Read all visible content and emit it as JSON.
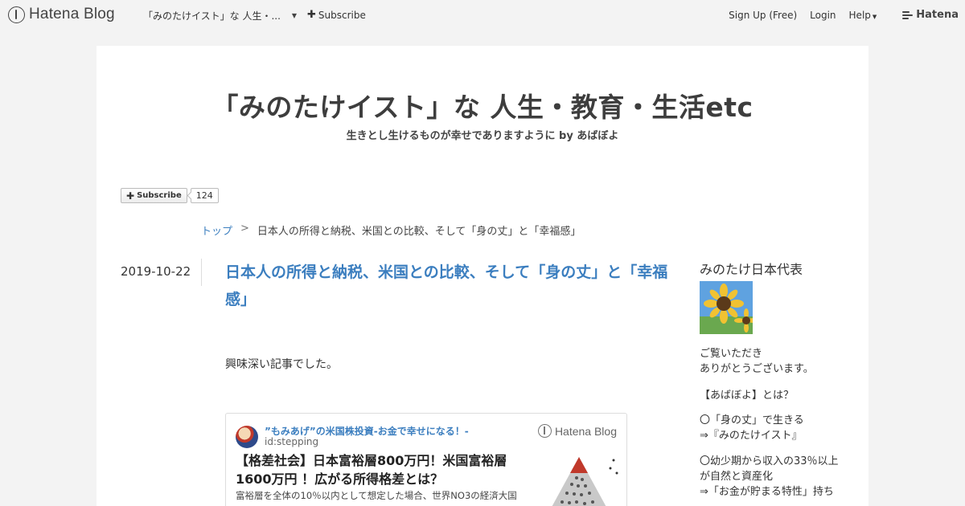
{
  "header": {
    "logo_text": "Hatena Blog",
    "blog_selector": "「みのたけイスト」な 人生・...",
    "subscribe": "Subscribe",
    "signup": "Sign Up (Free)",
    "login": "Login",
    "help": "Help",
    "brand": "Hatena"
  },
  "blog": {
    "title": "「みのたけイスト」な 人生・教育・生活etc",
    "description": "生きとし生けるものが幸せでありますように by あばぼよ"
  },
  "subscribe_widget": {
    "label": "Subscribe",
    "count": "124"
  },
  "breadcrumb": {
    "top": "トップ",
    "separator": ">",
    "current": "日本人の所得と納税、米国との比較、そして「身の丈」と「幸福感」"
  },
  "entry": {
    "date": "2019-10-22",
    "title": "日本人の所得と納税、米国との比較、そして「身の丈」と「幸福感」",
    "body": "興味深い記事でした。"
  },
  "embed_card": {
    "site": "”もみあげ”の米国株投資-お金で幸せになる！-",
    "id": "id:stepping",
    "brand": "Hatena Blog",
    "title": "【格差社会】日本富裕層800万円！米国富裕層1600万円 ！広がる所得格差とは？",
    "desc": "富裕層を全体の10％以内として想定した場合、世界NO3の経済大国"
  },
  "sidebar": {
    "profile_title": "みのたけ日本代表",
    "lines": [
      "ご覧いただき",
      "ありがとうございます。",
      "【あばぼよ】とは？",
      "〇「身の丈」で生きる",
      "⇒『みのたけイスト』",
      "〇幼少期から収入の33％以上",
      "が自然と資産化",
      "⇒「お金が貯まる特性」持ち"
    ]
  },
  "colors": {
    "accent_link": "#3b7ebf",
    "page_background": "#f3f3f3",
    "text": "#3d3d3d"
  }
}
